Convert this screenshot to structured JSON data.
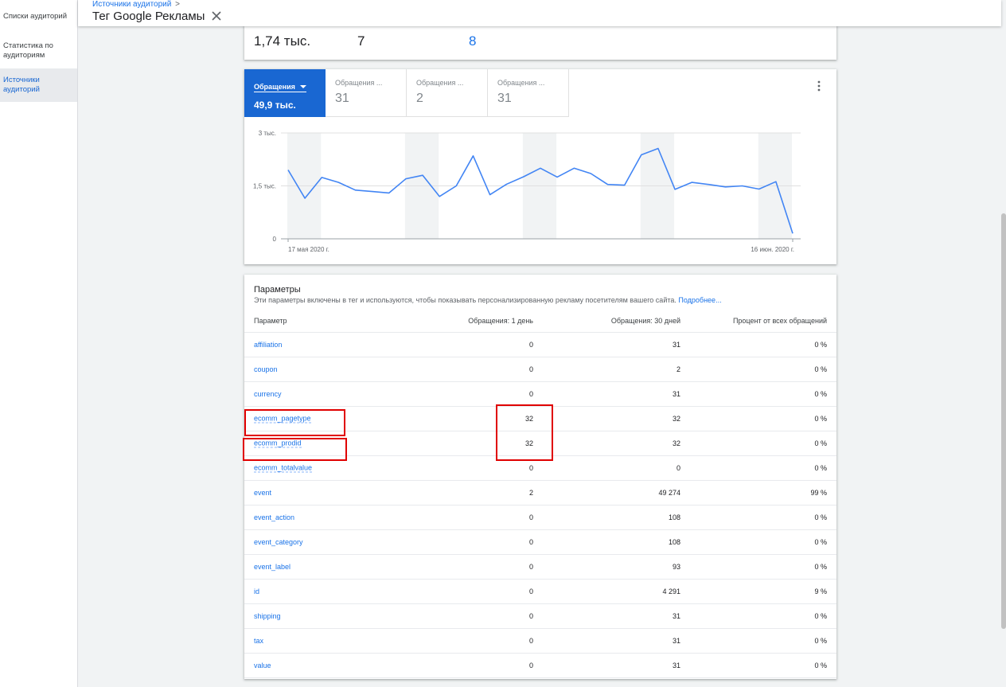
{
  "sidebar": {
    "items": [
      {
        "label": "Списки аудиторий",
        "active": false
      },
      {
        "label": "Статистика по аудиториям",
        "active": false
      },
      {
        "label": "Источники аудиторий",
        "active": true
      }
    ]
  },
  "header": {
    "breadcrumb": "Источники аудиторий",
    "breadcrumb_chevron": ">",
    "title": "Тег Google Рекламы"
  },
  "top_card": {
    "stats": [
      "1,74 тыс.",
      "7",
      "8"
    ]
  },
  "metrics": {
    "tabs": [
      {
        "label": "Обращения",
        "value": "49,9 тыс.",
        "active": true
      },
      {
        "label": "Обращения ...",
        "value": "31",
        "active": false
      },
      {
        "label": "Обращения ...",
        "value": "2",
        "active": false
      },
      {
        "label": "Обращения ...",
        "value": "31",
        "active": false
      }
    ]
  },
  "chart_data": {
    "type": "line",
    "y_tick_labels": [
      "3 тыс.",
      "1,5 тыс.",
      "0"
    ],
    "ylim": [
      0,
      3000
    ],
    "x_tick_labels": [
      "17 мая 2020 г.",
      "16 июн. 2020 г."
    ],
    "grid": true,
    "weekend_bands": true,
    "color": "#4285f4",
    "series": [
      {
        "values": [
          1950,
          1150,
          1740,
          1600,
          1380,
          1340,
          1300,
          1700,
          1800,
          1200,
          1500,
          2350,
          1250,
          1550,
          1760,
          2000,
          1750,
          2000,
          1850,
          1540,
          1520,
          2380,
          2560,
          1400,
          1600,
          1540,
          1470,
          1500,
          1410,
          1620,
          150
        ]
      }
    ]
  },
  "params": {
    "title": "Параметры",
    "description": "Эти параметры включены в тег и используются, чтобы показывать персонализированную рекламу посетителям вашего сайта.",
    "learn_more": "Подробнее...",
    "columns": [
      "Параметр",
      "Обращения: 1 день",
      "Обращения: 30 дней",
      "Процент от всех обращений"
    ],
    "rows": [
      {
        "name": "affiliation",
        "d1": "0",
        "d30": "31",
        "pct": "0 %"
      },
      {
        "name": "coupon",
        "d1": "0",
        "d30": "2",
        "pct": "0 %"
      },
      {
        "name": "currency",
        "d1": "0",
        "d30": "31",
        "pct": "0 %"
      },
      {
        "name": "ecomm_pagetype",
        "d1": "32",
        "d30": "32",
        "pct": "0 %"
      },
      {
        "name": "ecomm_prodid",
        "d1": "32",
        "d30": "32",
        "pct": "0 %"
      },
      {
        "name": "ecomm_totalvalue",
        "d1": "0",
        "d30": "0",
        "pct": "0 %"
      },
      {
        "name": "event",
        "d1": "2",
        "d30": "49 274",
        "pct": "99 %"
      },
      {
        "name": "event_action",
        "d1": "0",
        "d30": "108",
        "pct": "0 %"
      },
      {
        "name": "event_category",
        "d1": "0",
        "d30": "108",
        "pct": "0 %"
      },
      {
        "name": "event_label",
        "d1": "0",
        "d30": "93",
        "pct": "0 %"
      },
      {
        "name": "id",
        "d1": "0",
        "d30": "4 291",
        "pct": "9 %"
      },
      {
        "name": "shipping",
        "d1": "0",
        "d30": "31",
        "pct": "0 %"
      },
      {
        "name": "tax",
        "d1": "0",
        "d30": "31",
        "pct": "0 %"
      },
      {
        "name": "value",
        "d1": "0",
        "d30": "31",
        "pct": "0 %"
      }
    ]
  },
  "colors": {
    "accent": "#1967d2",
    "link": "#1a73e8",
    "annotation": "#e00000"
  }
}
